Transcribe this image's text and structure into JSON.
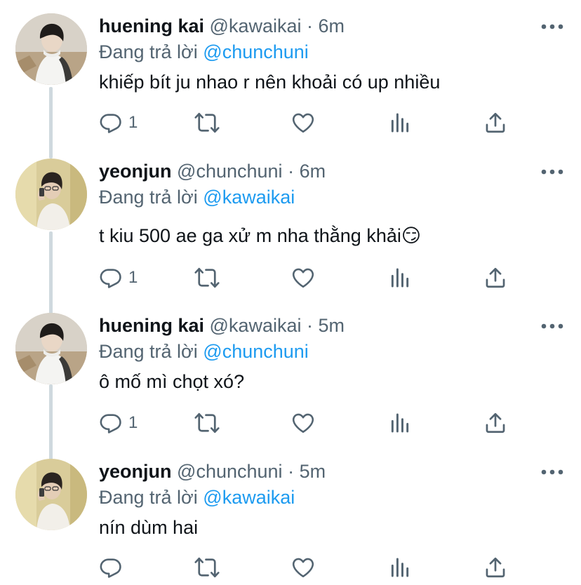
{
  "reply_prefix": "Đang trả lời",
  "tweets": [
    {
      "name": "huening kai",
      "handle": "@kawaikai",
      "separator": "·",
      "time": "6m",
      "reply_to": "@chunchuni",
      "text": "khiếp bít ju nhao r nên khoải có up nhiều",
      "reply_count": "1"
    },
    {
      "name": "yeonjun",
      "handle": "@chunchuni",
      "separator": "·",
      "time": "6m",
      "reply_to": "@kawaikai",
      "text": "t kiu 500 ae ga xử m nha thằng khải😏",
      "reply_count": "1"
    },
    {
      "name": "huening kai",
      "handle": "@kawaikai",
      "separator": "·",
      "time": "5m",
      "reply_to": "@chunchuni",
      "text": "ô mố mì chọt xó?",
      "reply_count": "1"
    },
    {
      "name": "yeonjun",
      "handle": "@chunchuni",
      "separator": "·",
      "time": "5m",
      "reply_to": "@kawaikai",
      "text": "nín dùm hai",
      "reply_count": ""
    }
  ],
  "colors": {
    "link": "#1d9bf0",
    "secondary": "#536471",
    "thread_line": "#cfd9de"
  },
  "icons": [
    "reply-icon",
    "retweet-icon",
    "like-icon",
    "analytics-icon",
    "share-icon",
    "more-icon"
  ]
}
